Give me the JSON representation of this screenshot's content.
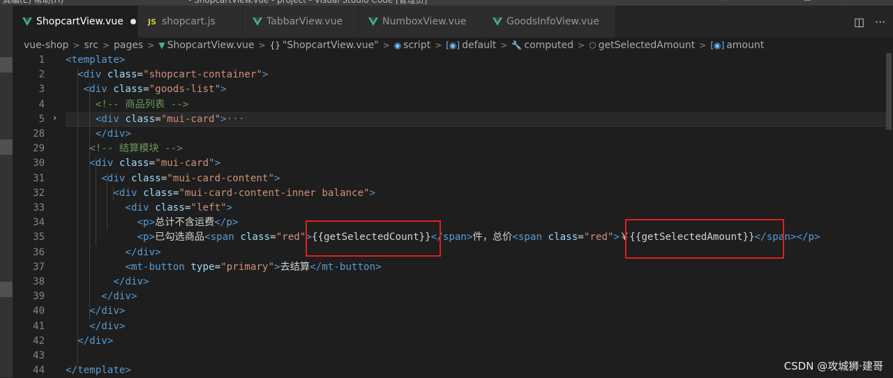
{
  "window": {
    "title": "- ShopcartView.vue - project - Visual Studio Code [管理员]",
    "menu": "其编(E)   帮助(H)"
  },
  "tabs": [
    {
      "label": "ShopcartView.vue",
      "icon": "vue-icon",
      "active": true,
      "dirty": true
    },
    {
      "label": "shopcart.js",
      "icon": "js-icon",
      "icon_text": "JS"
    },
    {
      "label": "TabbarView.vue",
      "icon": "vue-icon"
    },
    {
      "label": "NumboxView.vue",
      "icon": "vue-icon"
    },
    {
      "label": "GoodsInfoView.vue",
      "icon": "vue-icon"
    }
  ],
  "breadcrumb": {
    "items": [
      "vue-shop",
      "src",
      "pages",
      "ShopcartView.vue",
      "\"ShopcartView.vue\"",
      "script",
      "default",
      "computed",
      "getSelectedAmount",
      "amount"
    ],
    "brace_icon": "{}",
    "separator": ">"
  },
  "editor": {
    "line_numbers": [
      "1",
      "2",
      "3",
      "4",
      "5",
      "28",
      "29",
      "30",
      "31",
      "32",
      "33",
      "34",
      "35",
      "36",
      "37",
      "38",
      "39",
      "40",
      "41",
      "42",
      "43",
      "44"
    ],
    "lines": [
      {
        "indent": "",
        "tokens": [
          [
            "t",
            "<template"
          ],
          [
            "t",
            ">"
          ]
        ]
      },
      {
        "indent": "  ",
        "tokens": [
          [
            "t",
            "<div"
          ],
          [
            "x",
            " "
          ],
          [
            "a",
            "class"
          ],
          [
            "x",
            "="
          ],
          [
            "s",
            "\"shopcart-container\""
          ],
          [
            "t",
            ">"
          ]
        ]
      },
      {
        "indent": "   ",
        "tokens": [
          [
            "t",
            "<div"
          ],
          [
            "x",
            " "
          ],
          [
            "a",
            "class"
          ],
          [
            "x",
            "="
          ],
          [
            "s",
            "\"goods-list\""
          ],
          [
            "t",
            ">"
          ]
        ]
      },
      {
        "indent": "     ",
        "tokens": [
          [
            "c",
            "<!-- 商品列表 -->"
          ]
        ]
      },
      {
        "indent": "     ",
        "tokens": [
          [
            "t",
            "<div"
          ],
          [
            "x",
            " "
          ],
          [
            "a",
            "class"
          ],
          [
            "x",
            "="
          ],
          [
            "s",
            "\"mui-card\""
          ],
          [
            "t",
            ">"
          ],
          [
            "p",
            "···"
          ]
        ]
      },
      {
        "indent": "     ",
        "tokens": [
          [
            "t",
            "</div"
          ],
          [
            "t",
            ">"
          ]
        ]
      },
      {
        "indent": "    ",
        "tokens": [
          [
            "c",
            "<!-- 结算模块 -->"
          ]
        ]
      },
      {
        "indent": "    ",
        "tokens": [
          [
            "t",
            "<div"
          ],
          [
            "x",
            " "
          ],
          [
            "a",
            "class"
          ],
          [
            "x",
            "="
          ],
          [
            "s",
            "\"mui-card\""
          ],
          [
            "t",
            ">"
          ]
        ]
      },
      {
        "indent": "      ",
        "tokens": [
          [
            "t",
            "<div"
          ],
          [
            "x",
            " "
          ],
          [
            "a",
            "class"
          ],
          [
            "x",
            "="
          ],
          [
            "s",
            "\"mui-card-content\""
          ],
          [
            "t",
            ">"
          ]
        ]
      },
      {
        "indent": "        ",
        "tokens": [
          [
            "t",
            "<div"
          ],
          [
            "x",
            " "
          ],
          [
            "a",
            "class"
          ],
          [
            "x",
            "="
          ],
          [
            "s",
            "\"mui-card-content-inner balance\""
          ],
          [
            "t",
            ">"
          ]
        ]
      },
      {
        "indent": "          ",
        "tokens": [
          [
            "t",
            "<div"
          ],
          [
            "x",
            " "
          ],
          [
            "a",
            "class"
          ],
          [
            "x",
            "="
          ],
          [
            "s",
            "\"left\""
          ],
          [
            "t",
            ">"
          ]
        ]
      },
      {
        "indent": "            ",
        "tokens": [
          [
            "t",
            "<p>"
          ],
          [
            "x",
            "总计不含运费"
          ],
          [
            "t",
            "</p>"
          ]
        ]
      },
      {
        "indent": "            ",
        "tokens": [
          [
            "t",
            "<p>"
          ],
          [
            "x",
            "已勾选商品"
          ],
          [
            "t",
            "<span"
          ],
          [
            "x",
            " "
          ],
          [
            "a",
            "class"
          ],
          [
            "x",
            "="
          ],
          [
            "s",
            "\"red\""
          ],
          [
            "t",
            ">"
          ],
          [
            "x",
            "{{getSelectedCount}}"
          ],
          [
            "t",
            "</span>"
          ],
          [
            "x",
            "件，总价"
          ],
          [
            "t",
            "<span"
          ],
          [
            "x",
            " "
          ],
          [
            "a",
            "class"
          ],
          [
            "x",
            "="
          ],
          [
            "s",
            "\"red\""
          ],
          [
            "t",
            ">"
          ],
          [
            "x",
            "￥{{getSelectedAmount}}"
          ],
          [
            "t",
            "</span>"
          ],
          [
            "t",
            "</p>"
          ]
        ]
      },
      {
        "indent": "          ",
        "tokens": [
          [
            "t",
            "</div>"
          ]
        ]
      },
      {
        "indent": "          ",
        "tokens": [
          [
            "t",
            "<mt-button"
          ],
          [
            "x",
            " "
          ],
          [
            "a",
            "type"
          ],
          [
            "x",
            "="
          ],
          [
            "s",
            "\"primary\""
          ],
          [
            "t",
            ">"
          ],
          [
            "x",
            "去结算"
          ],
          [
            "t",
            "</mt-button>"
          ]
        ]
      },
      {
        "indent": "        ",
        "tokens": [
          [
            "t",
            "</div>"
          ]
        ]
      },
      {
        "indent": "      ",
        "tokens": [
          [
            "t",
            "</div>"
          ]
        ]
      },
      {
        "indent": "    ",
        "tokens": [
          [
            "t",
            "</div>"
          ]
        ]
      },
      {
        "indent": "    ",
        "tokens": [
          [
            "t",
            "</div>"
          ]
        ]
      },
      {
        "indent": "  ",
        "tokens": [
          [
            "t",
            "</div>"
          ]
        ]
      },
      {
        "indent": "",
        "tokens": []
      },
      {
        "indent": "",
        "tokens": [
          [
            "t",
            "</template>"
          ]
        ]
      }
    ]
  },
  "colors": {
    "tag": "#569cd6",
    "attr": "#9cdcfe",
    "string": "#ce9178",
    "comment": "#6a9955",
    "highlight": "#e02020"
  },
  "watermark": "CSDN @攻城狮·建哥"
}
